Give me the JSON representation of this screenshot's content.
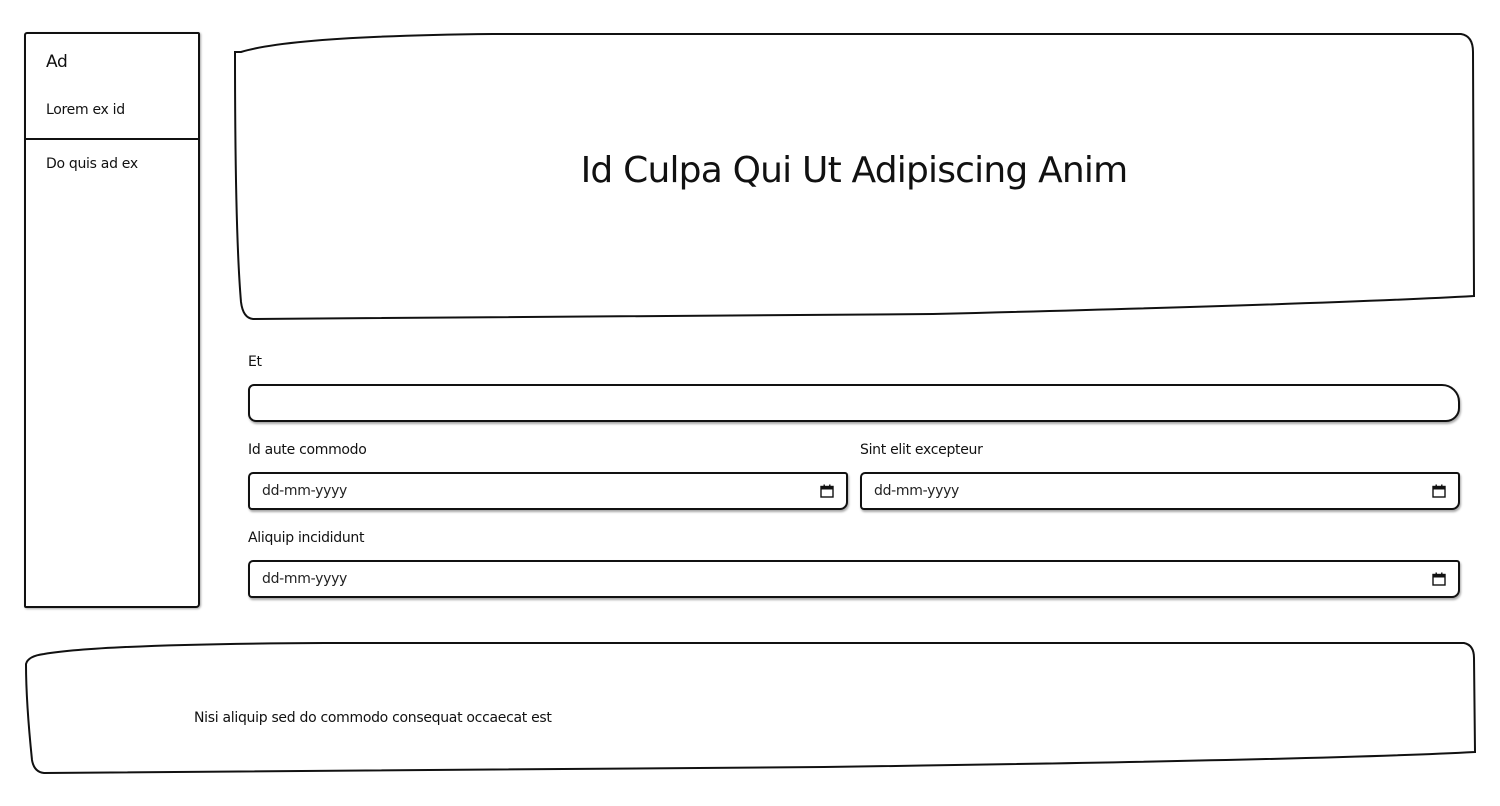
{
  "sidebar": {
    "title": "Ad",
    "subtitle": "Lorem ex id",
    "items": [
      {
        "label": "Do quis ad ex"
      }
    ]
  },
  "hero": {
    "title": "Id Culpa Qui Ut Adipiscing Anim"
  },
  "form": {
    "fields": {
      "et": {
        "label": "Et",
        "value": ""
      },
      "id_aute_commodo": {
        "label": "Id aute commodo",
        "placeholder": "dd-mm-yyyy"
      },
      "sint_elit_excepteur": {
        "label": "Sint elit excepteur",
        "placeholder": "dd-mm-yyyy"
      },
      "aliquip_incididunt": {
        "label": "Aliquip incididunt",
        "placeholder": "dd-mm-yyyy"
      }
    }
  },
  "footer": {
    "text": "Nisi aliquip sed do commodo consequat occaecat est"
  },
  "icons": {
    "date_picker": "calendar-icon"
  }
}
